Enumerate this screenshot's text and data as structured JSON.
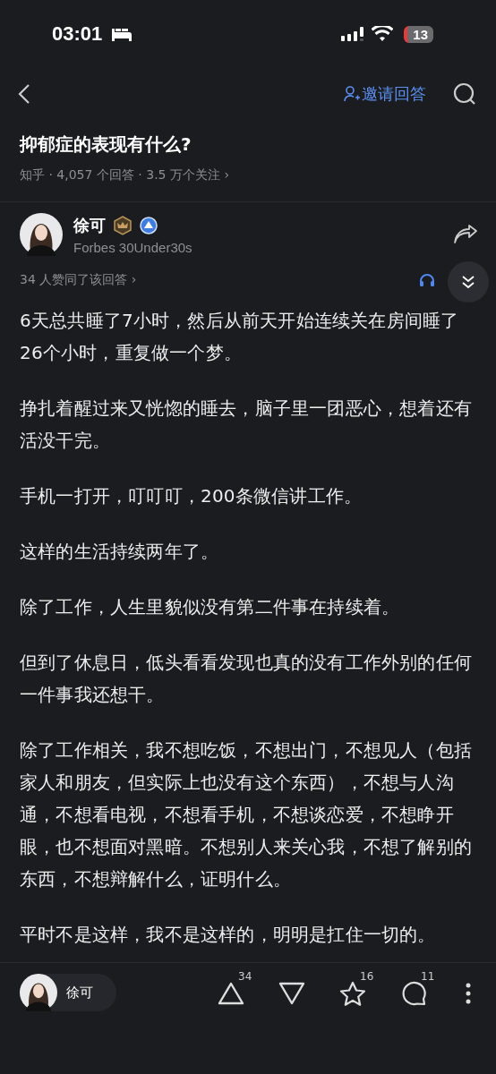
{
  "status_bar": {
    "time": "03:01",
    "battery": "13"
  },
  "nav": {
    "invite": "邀请回答"
  },
  "question": {
    "title": "抑郁症的表现有什么?",
    "meta": "知乎 · 4,057 个回答 · 3.5 万个关注 ›"
  },
  "author": {
    "name": "徐可",
    "bio": "Forbes 30Under30s"
  },
  "upvote_note": "34 人赞同了该回答 ›",
  "paragraphs": [
    "6天总共睡了7小时，然后从前天开始连续关在房间睡了26个小时，重复做一个梦。",
    "挣扎着醒过来又恍惚的睡去，脑子里一团恶心，想着还有活没干完。",
    "手机一打开，叮叮叮，200条微信讲工作。",
    "这样的生活持续两年了。",
    "除了工作，人生里貌似没有第二件事在持续着。",
    "但到了休息日，低头看看发现也真的没有工作外别的任何一件事我还想干。",
    "除了工作相关，我不想吃饭，不想出门，不想见人（包括家人和朋友，但实际上也没有这个东西），不想与人沟通，不想看电视，不想看手机，不想谈恋爱，不想睁开眼，也不想面对黑暗。不想别人来关心我，不想了解别的东西，不想辩解什么，证明什么。",
    "平时不是这样，我不是这样的，明明是扛住一切的。"
  ],
  "bottom_bar": {
    "author": "徐可",
    "actions": [
      {
        "kind": "upvote",
        "count": "34"
      },
      {
        "kind": "downvote"
      },
      {
        "kind": "favorite",
        "count": "16"
      },
      {
        "kind": "comment",
        "count": "11"
      },
      {
        "kind": "more"
      }
    ]
  }
}
